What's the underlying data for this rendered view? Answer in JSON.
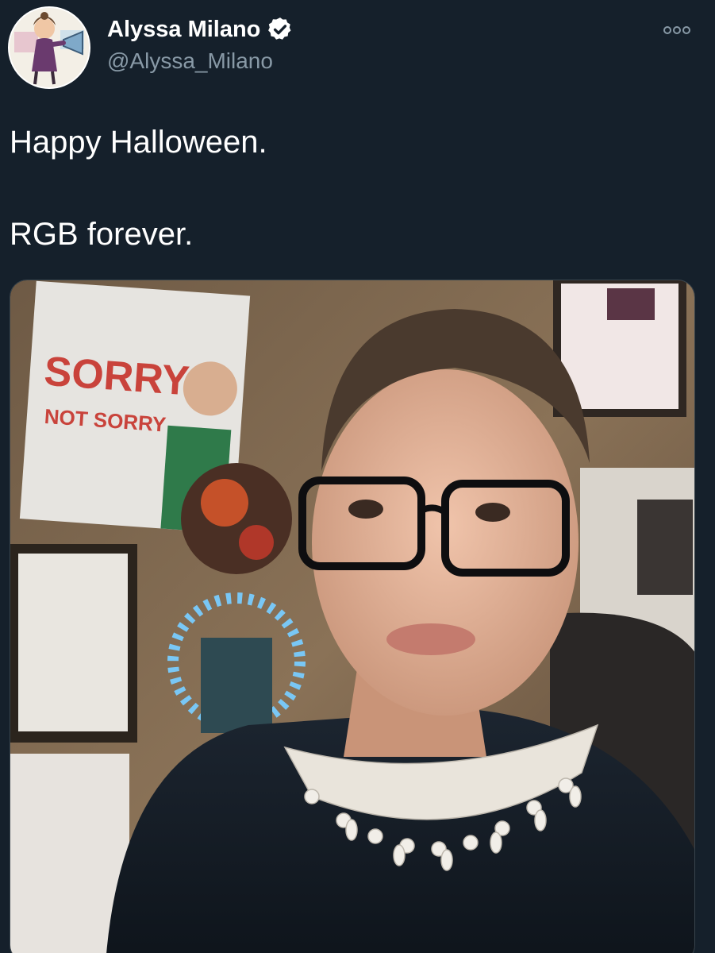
{
  "author": {
    "display_name": "Alyssa Milano",
    "handle": "@Alyssa_Milano",
    "verified": true,
    "avatar_icon": "caricature-avatar"
  },
  "tweet": {
    "lines": [
      "Happy Halloween.",
      "RGB forever."
    ]
  },
  "media": {
    "description_icon": "selfie-photo",
    "poster_text_line1": "SORRY",
    "poster_text_line2": "NOT SORRY"
  },
  "icons": {
    "verified": "verified-badge-icon",
    "more": "more-options-icon"
  },
  "colors": {
    "background": "#15202b",
    "text_primary": "#ffffff",
    "text_secondary": "#8899a6",
    "border": "#38444d"
  }
}
